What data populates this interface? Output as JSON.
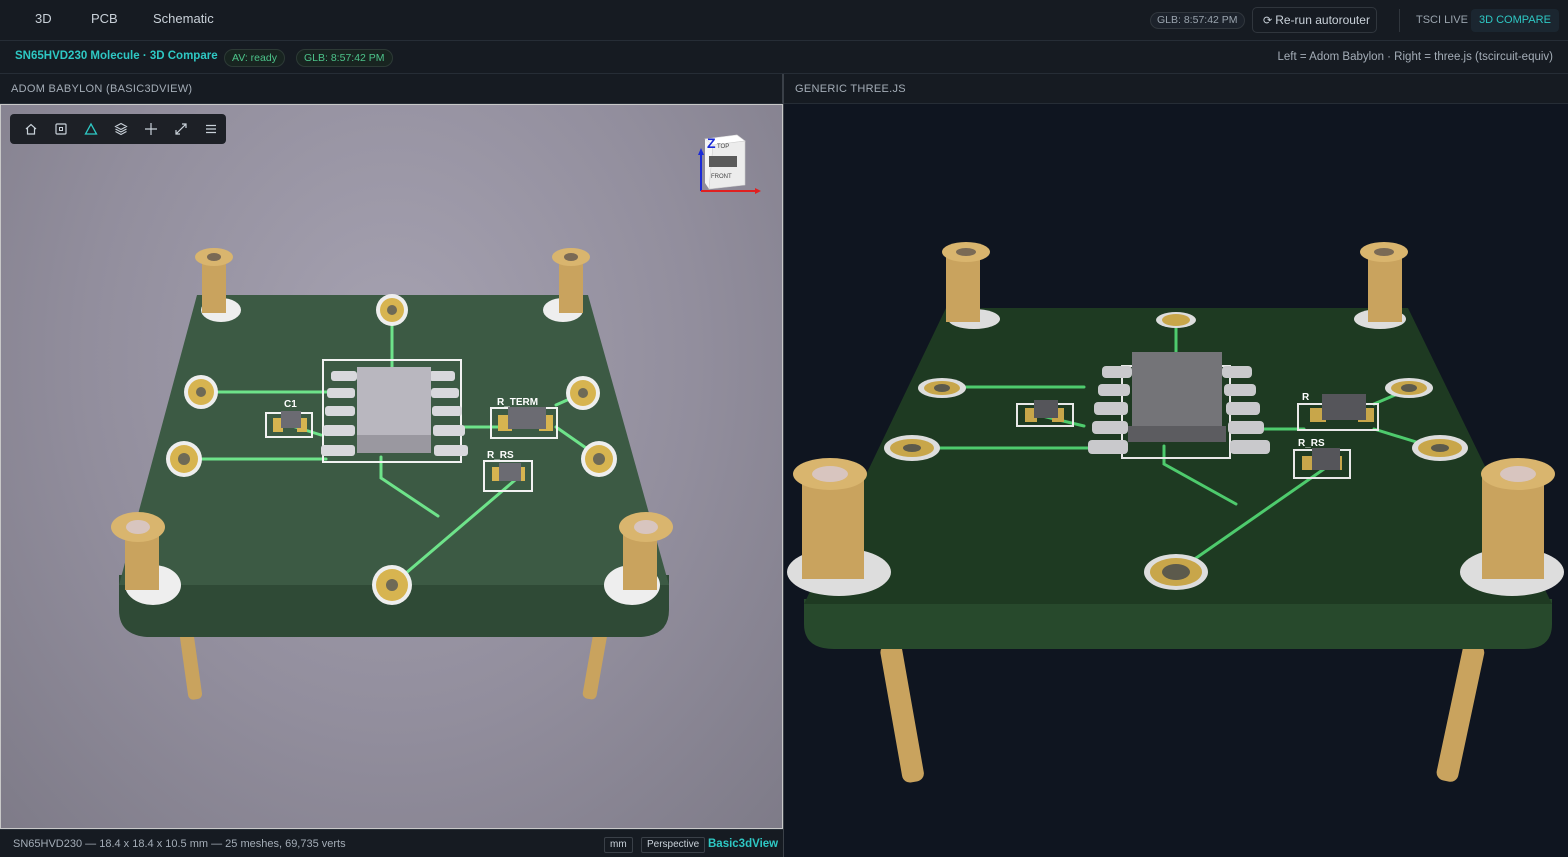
{
  "nav": {
    "tabs": [
      "3D",
      "PCB",
      "Schematic"
    ]
  },
  "header": {
    "glb_time": "GLB: 8:57:42 PM",
    "rerun_label": "Re-run autorouter",
    "mode_live": "TSCI LIVE",
    "mode_compare": "3D COMPARE"
  },
  "subbar": {
    "title": "SN65HVD230 Molecule · 3D Compare",
    "av_status": "AV: ready",
    "glb_status": "GLB: 8:57:42 PM",
    "note": "Left = Adom Babylon · Right = three.js (tscircuit-equiv)"
  },
  "panes": {
    "left_title": "ADOM BABYLON (BASIC3DVIEW)",
    "right_title": "GENERIC THREE.JS"
  },
  "viewer": {
    "toolbar_icons": [
      "home-icon",
      "frame-icon",
      "triangle-icon",
      "layers-icon",
      "move-icon",
      "expand-icon",
      "menu-icon"
    ],
    "active_tool": "triangle-icon",
    "cube_top": "TOP",
    "cube_front": "FRONT",
    "axis_z": "Z"
  },
  "pcb": {
    "labels": {
      "c1": "C1",
      "r_term": "R_TERM",
      "r_rs": "R_RS",
      "r_short": "R",
      "r_term_partial": "R_"
    }
  },
  "status": {
    "info": "SN65HVD230 — 18.4 x 18.4 x 10.5 mm — 25 meshes, 69,735 verts",
    "unit": "mm",
    "projection": "Perspective",
    "brand": "Basic3dView"
  },
  "colors": {
    "accent": "#2ec8c4",
    "ready": "#4cc38a",
    "board_left": "#3c5a44",
    "board_right": "#1e3a22",
    "trace": "#6ee38a",
    "pin": "#d9b56e"
  }
}
